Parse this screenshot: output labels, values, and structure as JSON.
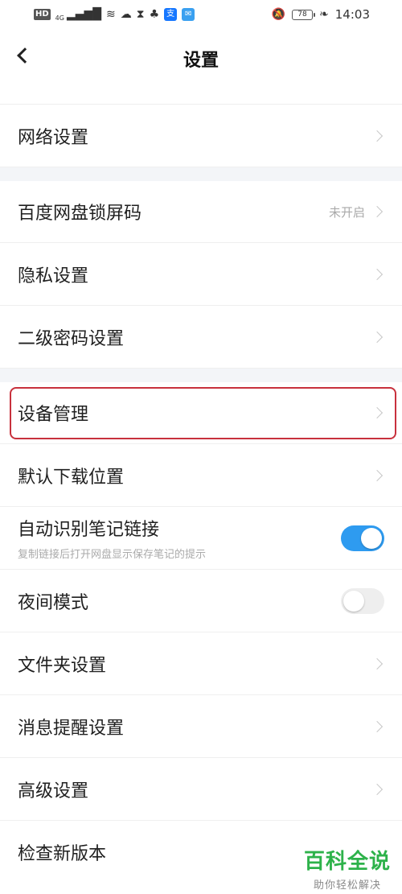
{
  "status_bar": {
    "hd": "HD",
    "network": "4G",
    "battery": "78",
    "time": "14:03",
    "icons": [
      "signal-icon",
      "wifi-icon",
      "baidu-cloud-icon",
      "hourglass-icon",
      "app-icon",
      "alipay-icon",
      "message-app-icon",
      "mute-bell-icon",
      "leaf-icon"
    ]
  },
  "header": {
    "title": "设置",
    "back_icon": "chevron-left-icon"
  },
  "items": [
    {
      "label": "网络设置"
    },
    {
      "label": "百度网盘锁屏码",
      "value": "未开启"
    },
    {
      "label": "隐私设置"
    },
    {
      "label": "二级密码设置"
    },
    {
      "label": "设备管理"
    },
    {
      "label": "默认下载位置"
    },
    {
      "label": "自动识别笔记链接",
      "sub": "复制链接后打开网盘显示保存笔记的提示",
      "toggle": true
    },
    {
      "label": "夜间模式",
      "toggle": false
    },
    {
      "label": "文件夹设置"
    },
    {
      "label": "消息提醒设置"
    },
    {
      "label": "高级设置"
    },
    {
      "label": "检查新版本"
    }
  ],
  "colors": {
    "accent": "#2e9bf0",
    "highlight": "#c8313d",
    "section_gap": "#f3f5f8",
    "watermark": "#2db24a"
  },
  "watermark": {
    "main": "百科全说",
    "sub": "助你轻松解决"
  }
}
